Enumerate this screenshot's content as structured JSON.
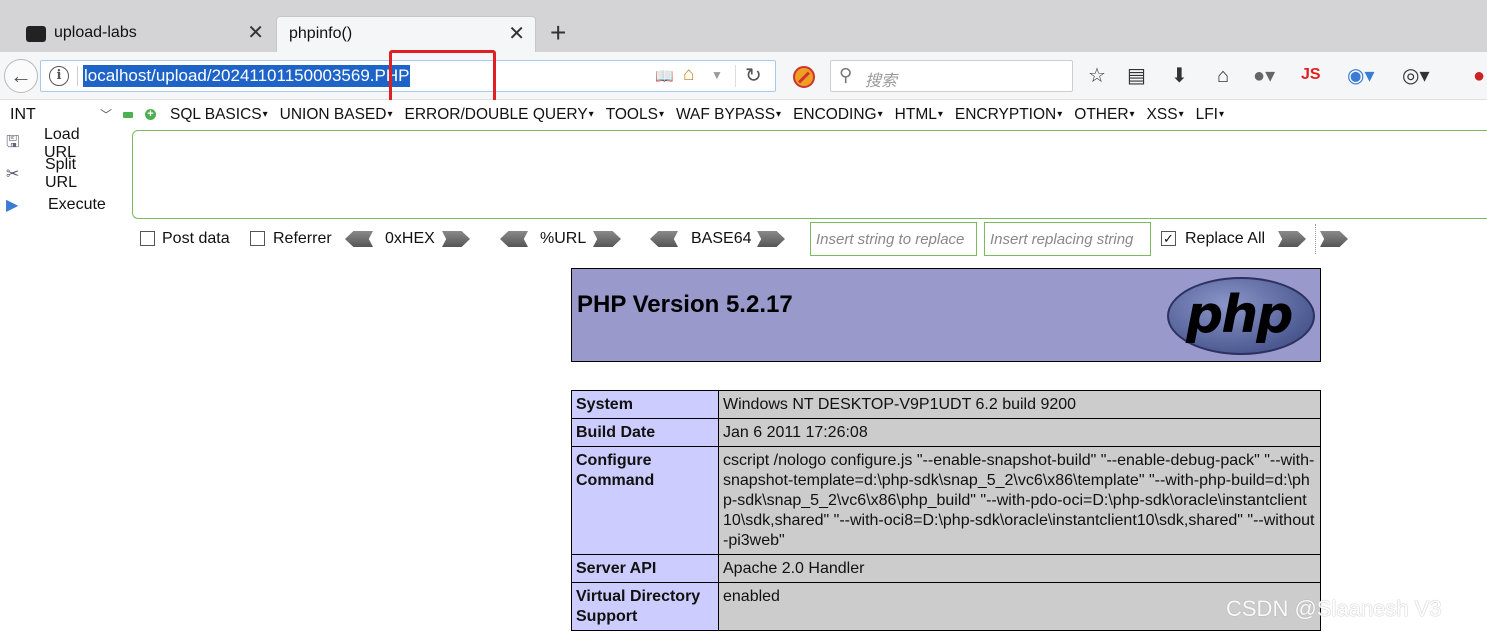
{
  "tabs": [
    {
      "title": "upload-labs",
      "active": false
    },
    {
      "title": "phpinfo()",
      "active": true
    }
  ],
  "nav": {
    "url": "localhost/upload/20241101150003569.PHP",
    "search_placeholder": "搜索",
    "js_label": "JS"
  },
  "hackbar": {
    "select_value": "INT",
    "menus": [
      "SQL BASICS",
      "UNION BASED",
      "ERROR/DOUBLE QUERY",
      "TOOLS",
      "WAF BYPASS",
      "ENCODING",
      "HTML",
      "ENCRYPTION",
      "OTHER",
      "XSS",
      "LFI"
    ],
    "load_url": "Load URL",
    "split_url": "Split URL",
    "execute": "Execute",
    "post_data": "Post data",
    "referrer": "Referrer",
    "hex": "0xHEX",
    "url_enc": "%URL",
    "base64": "BASE64",
    "insert_replace_ph": "Insert string to replace",
    "insert_replacing_ph": "Insert replacing string",
    "replace_all": "Replace All"
  },
  "phpinfo": {
    "version": "PHP Version 5.2.17",
    "logo_text": "php",
    "rows": [
      {
        "key": "System",
        "value": "Windows NT DESKTOP-V9P1UDT 6.2 build 9200"
      },
      {
        "key": "Build Date",
        "value": "Jan 6 2011 17:26:08"
      },
      {
        "key": "Configure Command",
        "value": "cscript /nologo configure.js \"--enable-snapshot-build\" \"--enable-debug-pack\" \"--with-snapshot-template=d:\\php-sdk\\snap_5_2\\vc6\\x86\\template\" \"--with-php-build=d:\\php-sdk\\snap_5_2\\vc6\\x86\\php_build\" \"--with-pdo-oci=D:\\php-sdk\\oracle\\instantclient10\\sdk,shared\" \"--with-oci8=D:\\php-sdk\\oracle\\instantclient10\\sdk,shared\" \"--without-pi3web\""
      },
      {
        "key": "Server API",
        "value": "Apache 2.0 Handler"
      },
      {
        "key": "Virtual Directory Support",
        "value": "enabled"
      }
    ]
  },
  "watermark": "CSDN @Slaanesh V3"
}
